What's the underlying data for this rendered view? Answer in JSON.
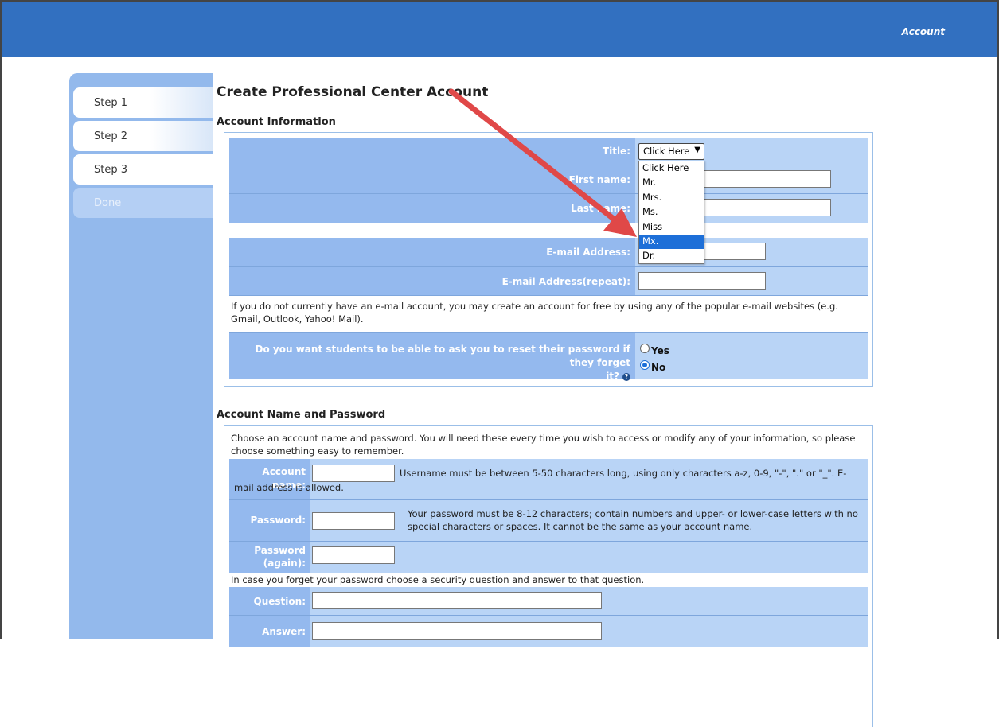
{
  "header": {
    "account_link": "Account"
  },
  "sidebar": {
    "steps": [
      {
        "label": "Step 1"
      },
      {
        "label": "Step 2"
      },
      {
        "label": "Step 3"
      },
      {
        "label": "Done"
      }
    ]
  },
  "page": {
    "title": "Create Professional Center Account"
  },
  "account_info": {
    "section_title": "Account Information",
    "title_label": "Title:",
    "title_selected": "Click Here",
    "title_options": [
      "Click Here",
      "Mr.",
      "Mrs.",
      "Ms.",
      "Miss",
      "Mx.",
      "Dr."
    ],
    "first_name_label": "First name:",
    "last_name_label": "Last name:",
    "email_label": "E-mail Address:",
    "email_repeat_label": "E-mail Address(repeat):",
    "email_note": "If you do not currently have an e-mail account, you may create an account for free by using any of the popular e-mail websites (e.g. Gmail, Outlook, Yahoo! Mail).",
    "reset_question_line1": "Do you want students to be able to ask you to reset their password if they forget",
    "reset_question_line2": "it?",
    "reset_yes": "Yes",
    "reset_no": "No"
  },
  "account_name_password": {
    "section_title": "Account Name and Password",
    "intro": "Choose an account name and password. You will need these every time you wish to access or modify any of your information, so please choose something easy to remember.",
    "account_label_line1": "Account",
    "account_label_line2": "name:",
    "account_hint_line1": "Username must be between 5-50 characters long, using only characters a-z, 0-9, \"-\", \".\" or \"_\". E-",
    "account_hint_line2": "mail address is allowed.",
    "password_label": "Password:",
    "password_hint": "Your password must be 8-12 characters; contain numbers and upper- or lower-case letters with no special characters or spaces. It cannot be the same as your account name.",
    "password_again_line1": "Password",
    "password_again_line2": "(again):",
    "security_note": "In case you forget your password choose a security question and answer to that question.",
    "question_label": "Question:",
    "answer_label": "Answer:"
  },
  "colors": {
    "header_bar": "#3270c0",
    "label_cell": "#94b9ee",
    "value_cell": "#b9d4f6",
    "annotation_arrow": "#e04848",
    "selection": "#1d6fd8"
  }
}
